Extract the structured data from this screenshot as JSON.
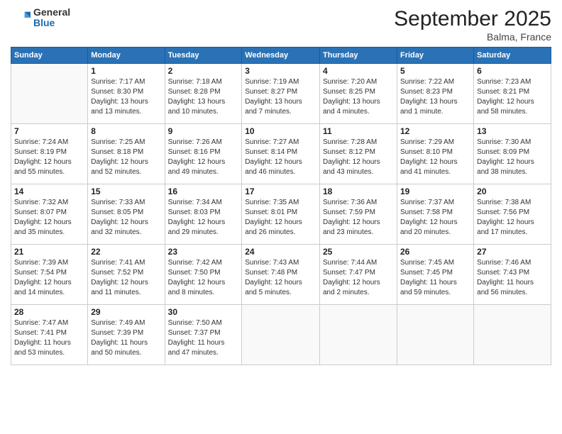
{
  "logo": {
    "general": "General",
    "blue": "Blue"
  },
  "title": "September 2025",
  "location": "Balma, France",
  "days_of_week": [
    "Sunday",
    "Monday",
    "Tuesday",
    "Wednesday",
    "Thursday",
    "Friday",
    "Saturday"
  ],
  "weeks": [
    [
      {
        "num": "",
        "info": ""
      },
      {
        "num": "1",
        "info": "Sunrise: 7:17 AM\nSunset: 8:30 PM\nDaylight: 13 hours\nand 13 minutes."
      },
      {
        "num": "2",
        "info": "Sunrise: 7:18 AM\nSunset: 8:28 PM\nDaylight: 13 hours\nand 10 minutes."
      },
      {
        "num": "3",
        "info": "Sunrise: 7:19 AM\nSunset: 8:27 PM\nDaylight: 13 hours\nand 7 minutes."
      },
      {
        "num": "4",
        "info": "Sunrise: 7:20 AM\nSunset: 8:25 PM\nDaylight: 13 hours\nand 4 minutes."
      },
      {
        "num": "5",
        "info": "Sunrise: 7:22 AM\nSunset: 8:23 PM\nDaylight: 13 hours\nand 1 minute."
      },
      {
        "num": "6",
        "info": "Sunrise: 7:23 AM\nSunset: 8:21 PM\nDaylight: 12 hours\nand 58 minutes."
      }
    ],
    [
      {
        "num": "7",
        "info": "Sunrise: 7:24 AM\nSunset: 8:19 PM\nDaylight: 12 hours\nand 55 minutes."
      },
      {
        "num": "8",
        "info": "Sunrise: 7:25 AM\nSunset: 8:18 PM\nDaylight: 12 hours\nand 52 minutes."
      },
      {
        "num": "9",
        "info": "Sunrise: 7:26 AM\nSunset: 8:16 PM\nDaylight: 12 hours\nand 49 minutes."
      },
      {
        "num": "10",
        "info": "Sunrise: 7:27 AM\nSunset: 8:14 PM\nDaylight: 12 hours\nand 46 minutes."
      },
      {
        "num": "11",
        "info": "Sunrise: 7:28 AM\nSunset: 8:12 PM\nDaylight: 12 hours\nand 43 minutes."
      },
      {
        "num": "12",
        "info": "Sunrise: 7:29 AM\nSunset: 8:10 PM\nDaylight: 12 hours\nand 41 minutes."
      },
      {
        "num": "13",
        "info": "Sunrise: 7:30 AM\nSunset: 8:09 PM\nDaylight: 12 hours\nand 38 minutes."
      }
    ],
    [
      {
        "num": "14",
        "info": "Sunrise: 7:32 AM\nSunset: 8:07 PM\nDaylight: 12 hours\nand 35 minutes."
      },
      {
        "num": "15",
        "info": "Sunrise: 7:33 AM\nSunset: 8:05 PM\nDaylight: 12 hours\nand 32 minutes."
      },
      {
        "num": "16",
        "info": "Sunrise: 7:34 AM\nSunset: 8:03 PM\nDaylight: 12 hours\nand 29 minutes."
      },
      {
        "num": "17",
        "info": "Sunrise: 7:35 AM\nSunset: 8:01 PM\nDaylight: 12 hours\nand 26 minutes."
      },
      {
        "num": "18",
        "info": "Sunrise: 7:36 AM\nSunset: 7:59 PM\nDaylight: 12 hours\nand 23 minutes."
      },
      {
        "num": "19",
        "info": "Sunrise: 7:37 AM\nSunset: 7:58 PM\nDaylight: 12 hours\nand 20 minutes."
      },
      {
        "num": "20",
        "info": "Sunrise: 7:38 AM\nSunset: 7:56 PM\nDaylight: 12 hours\nand 17 minutes."
      }
    ],
    [
      {
        "num": "21",
        "info": "Sunrise: 7:39 AM\nSunset: 7:54 PM\nDaylight: 12 hours\nand 14 minutes."
      },
      {
        "num": "22",
        "info": "Sunrise: 7:41 AM\nSunset: 7:52 PM\nDaylight: 12 hours\nand 11 minutes."
      },
      {
        "num": "23",
        "info": "Sunrise: 7:42 AM\nSunset: 7:50 PM\nDaylight: 12 hours\nand 8 minutes."
      },
      {
        "num": "24",
        "info": "Sunrise: 7:43 AM\nSunset: 7:48 PM\nDaylight: 12 hours\nand 5 minutes."
      },
      {
        "num": "25",
        "info": "Sunrise: 7:44 AM\nSunset: 7:47 PM\nDaylight: 12 hours\nand 2 minutes."
      },
      {
        "num": "26",
        "info": "Sunrise: 7:45 AM\nSunset: 7:45 PM\nDaylight: 11 hours\nand 59 minutes."
      },
      {
        "num": "27",
        "info": "Sunrise: 7:46 AM\nSunset: 7:43 PM\nDaylight: 11 hours\nand 56 minutes."
      }
    ],
    [
      {
        "num": "28",
        "info": "Sunrise: 7:47 AM\nSunset: 7:41 PM\nDaylight: 11 hours\nand 53 minutes."
      },
      {
        "num": "29",
        "info": "Sunrise: 7:49 AM\nSunset: 7:39 PM\nDaylight: 11 hours\nand 50 minutes."
      },
      {
        "num": "30",
        "info": "Sunrise: 7:50 AM\nSunset: 7:37 PM\nDaylight: 11 hours\nand 47 minutes."
      },
      {
        "num": "",
        "info": ""
      },
      {
        "num": "",
        "info": ""
      },
      {
        "num": "",
        "info": ""
      },
      {
        "num": "",
        "info": ""
      }
    ]
  ]
}
